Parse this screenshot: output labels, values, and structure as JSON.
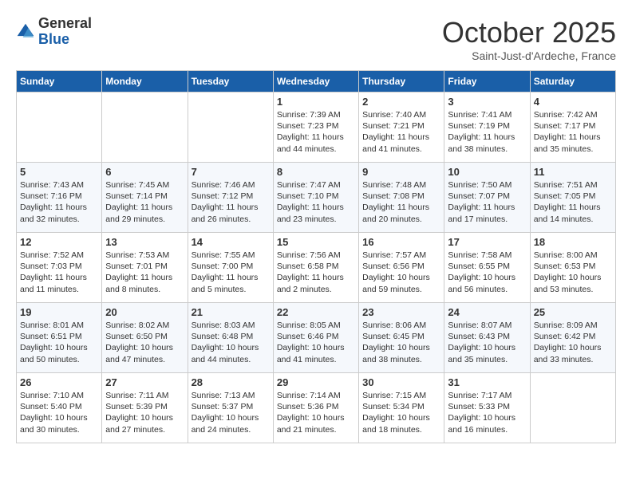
{
  "header": {
    "logo_general": "General",
    "logo_blue": "Blue",
    "month": "October 2025",
    "location": "Saint-Just-d'Ardeche, France"
  },
  "days_of_week": [
    "Sunday",
    "Monday",
    "Tuesday",
    "Wednesday",
    "Thursday",
    "Friday",
    "Saturday"
  ],
  "weeks": [
    [
      {
        "num": "",
        "info": ""
      },
      {
        "num": "",
        "info": ""
      },
      {
        "num": "",
        "info": ""
      },
      {
        "num": "1",
        "info": "Sunrise: 7:39 AM\nSunset: 7:23 PM\nDaylight: 11 hours\nand 44 minutes."
      },
      {
        "num": "2",
        "info": "Sunrise: 7:40 AM\nSunset: 7:21 PM\nDaylight: 11 hours\nand 41 minutes."
      },
      {
        "num": "3",
        "info": "Sunrise: 7:41 AM\nSunset: 7:19 PM\nDaylight: 11 hours\nand 38 minutes."
      },
      {
        "num": "4",
        "info": "Sunrise: 7:42 AM\nSunset: 7:17 PM\nDaylight: 11 hours\nand 35 minutes."
      }
    ],
    [
      {
        "num": "5",
        "info": "Sunrise: 7:43 AM\nSunset: 7:16 PM\nDaylight: 11 hours\nand 32 minutes."
      },
      {
        "num": "6",
        "info": "Sunrise: 7:45 AM\nSunset: 7:14 PM\nDaylight: 11 hours\nand 29 minutes."
      },
      {
        "num": "7",
        "info": "Sunrise: 7:46 AM\nSunset: 7:12 PM\nDaylight: 11 hours\nand 26 minutes."
      },
      {
        "num": "8",
        "info": "Sunrise: 7:47 AM\nSunset: 7:10 PM\nDaylight: 11 hours\nand 23 minutes."
      },
      {
        "num": "9",
        "info": "Sunrise: 7:48 AM\nSunset: 7:08 PM\nDaylight: 11 hours\nand 20 minutes."
      },
      {
        "num": "10",
        "info": "Sunrise: 7:50 AM\nSunset: 7:07 PM\nDaylight: 11 hours\nand 17 minutes."
      },
      {
        "num": "11",
        "info": "Sunrise: 7:51 AM\nSunset: 7:05 PM\nDaylight: 11 hours\nand 14 minutes."
      }
    ],
    [
      {
        "num": "12",
        "info": "Sunrise: 7:52 AM\nSunset: 7:03 PM\nDaylight: 11 hours\nand 11 minutes."
      },
      {
        "num": "13",
        "info": "Sunrise: 7:53 AM\nSunset: 7:01 PM\nDaylight: 11 hours\nand 8 minutes."
      },
      {
        "num": "14",
        "info": "Sunrise: 7:55 AM\nSunset: 7:00 PM\nDaylight: 11 hours\nand 5 minutes."
      },
      {
        "num": "15",
        "info": "Sunrise: 7:56 AM\nSunset: 6:58 PM\nDaylight: 11 hours\nand 2 minutes."
      },
      {
        "num": "16",
        "info": "Sunrise: 7:57 AM\nSunset: 6:56 PM\nDaylight: 10 hours\nand 59 minutes."
      },
      {
        "num": "17",
        "info": "Sunrise: 7:58 AM\nSunset: 6:55 PM\nDaylight: 10 hours\nand 56 minutes."
      },
      {
        "num": "18",
        "info": "Sunrise: 8:00 AM\nSunset: 6:53 PM\nDaylight: 10 hours\nand 53 minutes."
      }
    ],
    [
      {
        "num": "19",
        "info": "Sunrise: 8:01 AM\nSunset: 6:51 PM\nDaylight: 10 hours\nand 50 minutes."
      },
      {
        "num": "20",
        "info": "Sunrise: 8:02 AM\nSunset: 6:50 PM\nDaylight: 10 hours\nand 47 minutes."
      },
      {
        "num": "21",
        "info": "Sunrise: 8:03 AM\nSunset: 6:48 PM\nDaylight: 10 hours\nand 44 minutes."
      },
      {
        "num": "22",
        "info": "Sunrise: 8:05 AM\nSunset: 6:46 PM\nDaylight: 10 hours\nand 41 minutes."
      },
      {
        "num": "23",
        "info": "Sunrise: 8:06 AM\nSunset: 6:45 PM\nDaylight: 10 hours\nand 38 minutes."
      },
      {
        "num": "24",
        "info": "Sunrise: 8:07 AM\nSunset: 6:43 PM\nDaylight: 10 hours\nand 35 minutes."
      },
      {
        "num": "25",
        "info": "Sunrise: 8:09 AM\nSunset: 6:42 PM\nDaylight: 10 hours\nand 33 minutes."
      }
    ],
    [
      {
        "num": "26",
        "info": "Sunrise: 7:10 AM\nSunset: 5:40 PM\nDaylight: 10 hours\nand 30 minutes."
      },
      {
        "num": "27",
        "info": "Sunrise: 7:11 AM\nSunset: 5:39 PM\nDaylight: 10 hours\nand 27 minutes."
      },
      {
        "num": "28",
        "info": "Sunrise: 7:13 AM\nSunset: 5:37 PM\nDaylight: 10 hours\nand 24 minutes."
      },
      {
        "num": "29",
        "info": "Sunrise: 7:14 AM\nSunset: 5:36 PM\nDaylight: 10 hours\nand 21 minutes."
      },
      {
        "num": "30",
        "info": "Sunrise: 7:15 AM\nSunset: 5:34 PM\nDaylight: 10 hours\nand 18 minutes."
      },
      {
        "num": "31",
        "info": "Sunrise: 7:17 AM\nSunset: 5:33 PM\nDaylight: 10 hours\nand 16 minutes."
      },
      {
        "num": "",
        "info": ""
      }
    ]
  ]
}
